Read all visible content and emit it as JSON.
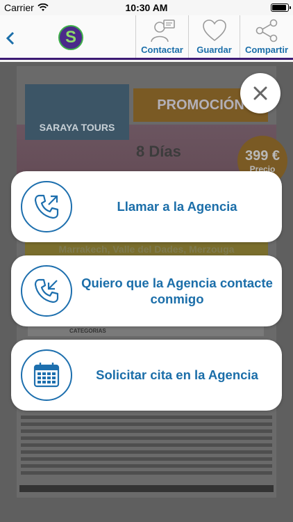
{
  "status_bar": {
    "carrier": "Carrier",
    "time": "10:30 AM",
    "battery_level": 0.95
  },
  "nav": {
    "back_icon": "chevron-left-icon",
    "logo_text": "S",
    "actions": [
      {
        "label": "Contactar",
        "icon": "contact-person-icon"
      },
      {
        "label": "Guardar",
        "icon": "heart-icon"
      },
      {
        "label": "Compartir",
        "icon": "share-icon"
      }
    ]
  },
  "poster": {
    "brand": "SARAYA TOURS",
    "promo": "PROMOCIÓN",
    "days": "8 Días",
    "price": "399 €",
    "price_label": "Precio",
    "route": "Marrakech, Valle del Dades, Merzouga",
    "category_header": "CATEGORIAS"
  },
  "modal": {
    "close_icon": "close-icon",
    "options": [
      {
        "label": "Llamar a la Agencia",
        "icon": "phone-outgoing-icon"
      },
      {
        "label": "Quiero que la Agencia contacte conmigo",
        "icon": "phone-incoming-icon"
      },
      {
        "label": "Solicitar cita en la Agencia",
        "icon": "calendar-icon"
      }
    ]
  },
  "colors": {
    "accent_blue": "#1b6ea9",
    "nav_border_purple": "#3c1a74",
    "overlay": "#5f5f5f"
  }
}
